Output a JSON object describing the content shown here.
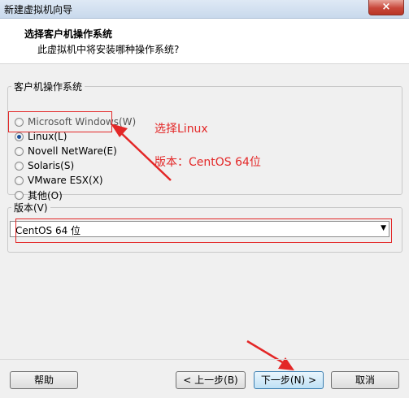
{
  "window": {
    "title": "新建虚拟机向导",
    "close_label": "×"
  },
  "header": {
    "title": "选择客户机操作系统",
    "subtitle": "此虚拟机中将安装哪种操作系统?"
  },
  "os_group": {
    "legend": "客户机操作系统",
    "options": [
      {
        "label": "Microsoft Windows(W)",
        "selected": false
      },
      {
        "label": "Linux(L)",
        "selected": true
      },
      {
        "label": "Novell NetWare(E)",
        "selected": false
      },
      {
        "label": "Solaris(S)",
        "selected": false
      },
      {
        "label": "VMware ESX(X)",
        "selected": false
      },
      {
        "label": "其他(O)",
        "selected": false
      }
    ]
  },
  "version_group": {
    "legend": "版本(V)",
    "selected": "CentOS 64 位"
  },
  "annotations": {
    "select_linux": "选择Linux",
    "version_note": "版本：CentOS 64位",
    "color": "#e32727"
  },
  "buttons": {
    "help": "帮助",
    "back": "< 上一步(B)",
    "next": "下一步(N) >",
    "cancel": "取消"
  },
  "icons": {
    "close": "close-icon",
    "dropdown": "chevron-down-icon"
  }
}
